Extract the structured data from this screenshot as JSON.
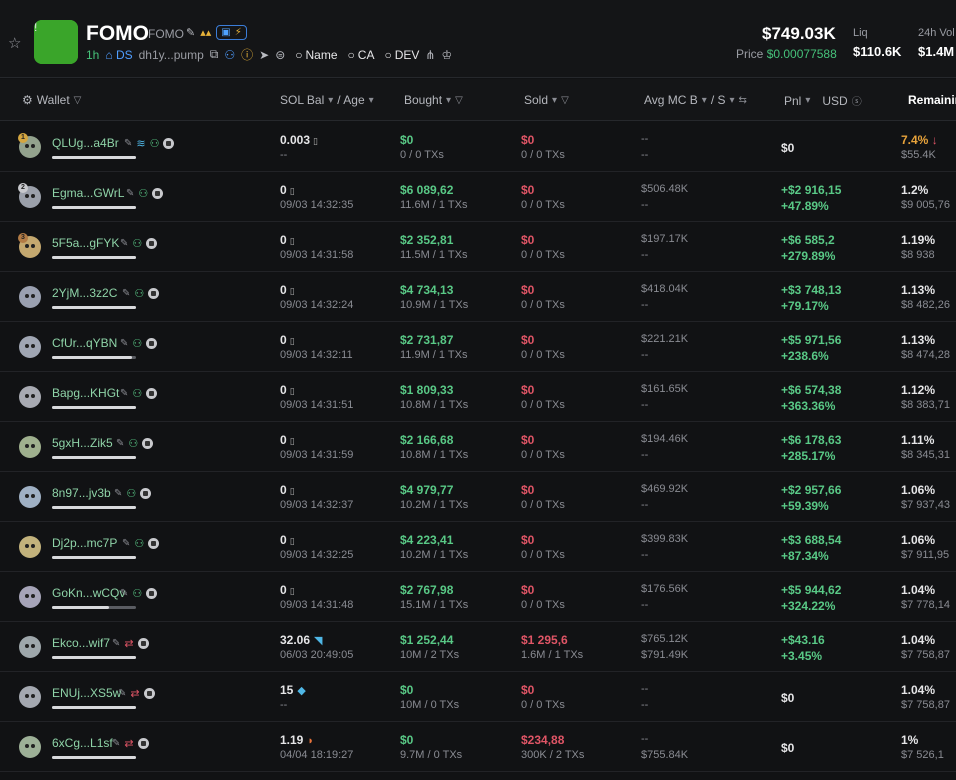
{
  "token": {
    "name": "FOMO",
    "symbol": "FOMO",
    "age": "1h",
    "ds_label": "DS",
    "contract": "dh1y...pump",
    "search_name": "Name",
    "search_ca": "CA",
    "search_dev": "DEV",
    "market_cap": "$749.03K",
    "price_label": "Price",
    "price": "$0.00077588",
    "liq_label": "Liq",
    "liq_value": "$110.6K",
    "vol_label": "24h Vol",
    "vol_value": "$1.4M"
  },
  "columns": {
    "wallet": "Wallet",
    "sol_bal": "SOL Bal",
    "age": "/ Age",
    "bought": "Bought",
    "sold": "Sold",
    "avg_mc": "Avg MC B",
    "avg_s": "/ S",
    "pnl": "Pnl",
    "usd": "USD",
    "remaining": "Remaining"
  },
  "rows": [
    {
      "rank": "1",
      "addr": "QLUg...a4Br",
      "bar": 1.0,
      "sol": "0.003",
      "age": "--",
      "bought": "$0",
      "bought_sub": "0 / 0 TXs",
      "sold": "$0",
      "sold_sub": "0 / 0 TXs",
      "mc_b": "--",
      "mc_s": "--",
      "pnl": "$0",
      "pnl_pct": "",
      "rem": "7.4%",
      "rem_sub": "$55.4K"
    },
    {
      "rank": "2",
      "addr": "Egma...GWrL",
      "bar": 1.0,
      "sol": "0",
      "age": "09/03 14:32:35",
      "bought": "$6 089,62",
      "bought_sub": "11.6M / 1 TXs",
      "sold": "$0",
      "sold_sub": "0 / 0 TXs",
      "mc_b": "$506.48K",
      "mc_s": "--",
      "pnl": "+$2 916,15",
      "pnl_pct": "+47.89%",
      "rem": "1.2%",
      "rem_sub": "$9 005,76"
    },
    {
      "rank": "3",
      "addr": "5F5a...gFYK",
      "bar": 1.0,
      "sol": "0",
      "age": "09/03 14:31:58",
      "bought": "$2 352,81",
      "bought_sub": "11.5M / 1 TXs",
      "sold": "$0",
      "sold_sub": "0 / 0 TXs",
      "mc_b": "$197.17K",
      "mc_s": "--",
      "pnl": "+$6 585,2",
      "pnl_pct": "+279.89%",
      "rem": "1.19%",
      "rem_sub": "$8 938"
    },
    {
      "rank": "",
      "addr": "2YjM...3z2C",
      "bar": 1.0,
      "sol": "0",
      "age": "09/03 14:32:24",
      "bought": "$4 734,13",
      "bought_sub": "10.9M / 1 TXs",
      "sold": "$0",
      "sold_sub": "0 / 0 TXs",
      "mc_b": "$418.04K",
      "mc_s": "--",
      "pnl": "+$3 748,13",
      "pnl_pct": "+79.17%",
      "rem": "1.13%",
      "rem_sub": "$8 482,26"
    },
    {
      "rank": "",
      "addr": "CfUr...qYBN",
      "bar": 0.95,
      "sol": "0",
      "age": "09/03 14:32:11",
      "bought": "$2 731,87",
      "bought_sub": "11.9M / 1 TXs",
      "sold": "$0",
      "sold_sub": "0 / 0 TXs",
      "mc_b": "$221.21K",
      "mc_s": "--",
      "pnl": "+$5 971,56",
      "pnl_pct": "+238.6%",
      "rem": "1.13%",
      "rem_sub": "$8 474,28"
    },
    {
      "rank": "",
      "addr": "Bapg...KHGt",
      "bar": 1.0,
      "sol": "0",
      "age": "09/03 14:31:51",
      "bought": "$1 809,33",
      "bought_sub": "10.8M / 1 TXs",
      "sold": "$0",
      "sold_sub": "0 / 0 TXs",
      "mc_b": "$161.65K",
      "mc_s": "--",
      "pnl": "+$6 574,38",
      "pnl_pct": "+363.36%",
      "rem": "1.12%",
      "rem_sub": "$8 383,71"
    },
    {
      "rank": "",
      "addr": "5gxH...Zik5",
      "bar": 1.0,
      "sol": "0",
      "age": "09/03 14:31:59",
      "bought": "$2 166,68",
      "bought_sub": "10.8M / 1 TXs",
      "sold": "$0",
      "sold_sub": "0 / 0 TXs",
      "mc_b": "$194.46K",
      "mc_s": "--",
      "pnl": "+$6 178,63",
      "pnl_pct": "+285.17%",
      "rem": "1.11%",
      "rem_sub": "$8 345,31"
    },
    {
      "rank": "",
      "addr": "8n97...jv3b",
      "bar": 1.0,
      "sol": "0",
      "age": "09/03 14:32:37",
      "bought": "$4 979,77",
      "bought_sub": "10.2M / 1 TXs",
      "sold": "$0",
      "sold_sub": "0 / 0 TXs",
      "mc_b": "$469.92K",
      "mc_s": "--",
      "pnl": "+$2 957,66",
      "pnl_pct": "+59.39%",
      "rem": "1.06%",
      "rem_sub": "$7 937,43"
    },
    {
      "rank": "",
      "addr": "Dj2p...mc7P",
      "bar": 1.0,
      "sol": "0",
      "age": "09/03 14:32:25",
      "bought": "$4 223,41",
      "bought_sub": "10.2M / 1 TXs",
      "sold": "$0",
      "sold_sub": "0 / 0 TXs",
      "mc_b": "$399.83K",
      "mc_s": "--",
      "pnl": "+$3 688,54",
      "pnl_pct": "+87.34%",
      "rem": "1.06%",
      "rem_sub": "$7 911,95"
    },
    {
      "rank": "",
      "addr": "GoKn...wCQv",
      "bar": 0.68,
      "sol": "0",
      "age": "09/03 14:31:48",
      "bought": "$2 767,98",
      "bought_sub": "15.1M / 1 TXs",
      "sold": "$0",
      "sold_sub": "0 / 0 TXs",
      "mc_b": "$176.56K",
      "mc_s": "--",
      "pnl": "+$5 944,62",
      "pnl_pct": "+324.22%",
      "rem": "1.04%",
      "rem_sub": "$7 778,14"
    },
    {
      "rank": "",
      "addr": "Ekco...wif7",
      "bar": 1.0,
      "sol": "32.06",
      "age": "06/03 20:49:05",
      "bought": "$1 252,44",
      "bought_sub": "10M / 2 TXs",
      "sold": "$1 295,6",
      "sold_sub": "1.6M / 1 TXs",
      "mc_b": "$765.12K",
      "mc_s": "$791.49K",
      "pnl": "+$43.16",
      "pnl_pct": "+3.45%",
      "rem": "1.04%",
      "rem_sub": "$7 758,87"
    },
    {
      "rank": "",
      "addr": "ENUj...XS5w",
      "bar": 1.0,
      "sol": "15",
      "age": "--",
      "bought": "$0",
      "bought_sub": "10M / 0 TXs",
      "sold": "$0",
      "sold_sub": "0 / 0 TXs",
      "mc_b": "--",
      "mc_s": "--",
      "pnl": "$0",
      "pnl_pct": "",
      "rem": "1.04%",
      "rem_sub": "$7 758,87"
    },
    {
      "rank": "",
      "addr": "6xCg...L1sf",
      "bar": 1.0,
      "sol": "1.19",
      "age": "04/04 18:19:27",
      "bought": "$0",
      "bought_sub": "9.7M / 0 TXs",
      "sold": "$234,88",
      "sold_sub": "300K / 2 TXs",
      "mc_b": "--",
      "mc_s": "$755.84K",
      "pnl": "$0",
      "pnl_pct": "",
      "rem": "1%",
      "rem_sub": "$7 526,1"
    }
  ]
}
